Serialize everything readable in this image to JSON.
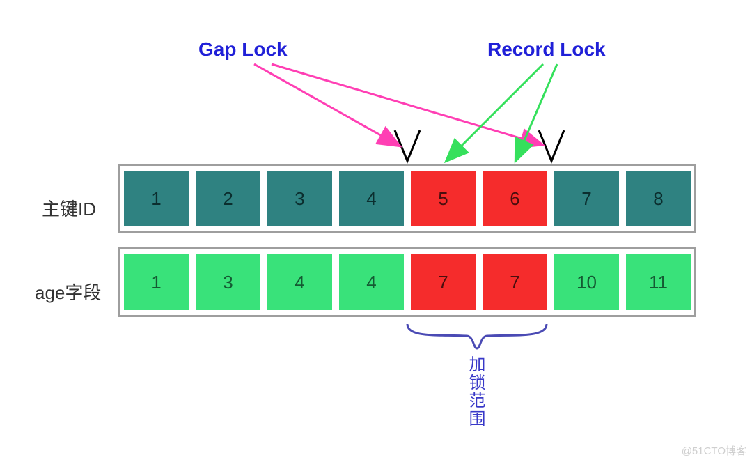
{
  "chart_data": {
    "type": "table",
    "rows": [
      {
        "label": "主键ID",
        "values": [
          1,
          2,
          3,
          4,
          5,
          6,
          7,
          8
        ],
        "cell_color": [
          "teal",
          "teal",
          "teal",
          "teal",
          "red",
          "red",
          "teal",
          "teal"
        ]
      },
      {
        "label": "age字段",
        "values": [
          1,
          3,
          4,
          4,
          7,
          7,
          10,
          11
        ],
        "cell_color": [
          "green",
          "green",
          "green",
          "green",
          "red",
          "red",
          "green",
          "green"
        ]
      }
    ],
    "locked_range_indices": [
      4,
      5
    ],
    "locked_range_label": "加锁范围",
    "annotations": {
      "gap_lock_label": "Gap Lock",
      "record_lock_label": "Record Lock",
      "gap_lock_targets": [
        "gap-between-4-5",
        "gap-between-6-7"
      ],
      "record_lock_targets": [
        "pk-5",
        "pk-6"
      ]
    }
  },
  "labels": {
    "gap_lock": "Gap Lock",
    "record_lock": "Record Lock",
    "row1": "主键ID",
    "row2": "age字段",
    "lock_range": "加锁范围",
    "watermark": "@51CTO博客"
  },
  "colors": {
    "teal": "#2f8281",
    "green": "#39e27a",
    "red": "#f52c2c",
    "label_blue": "#2020d8",
    "arrow_pink": "#ff3fb4",
    "arrow_green": "#35e05c",
    "brace_purple": "#4a4ab4"
  }
}
